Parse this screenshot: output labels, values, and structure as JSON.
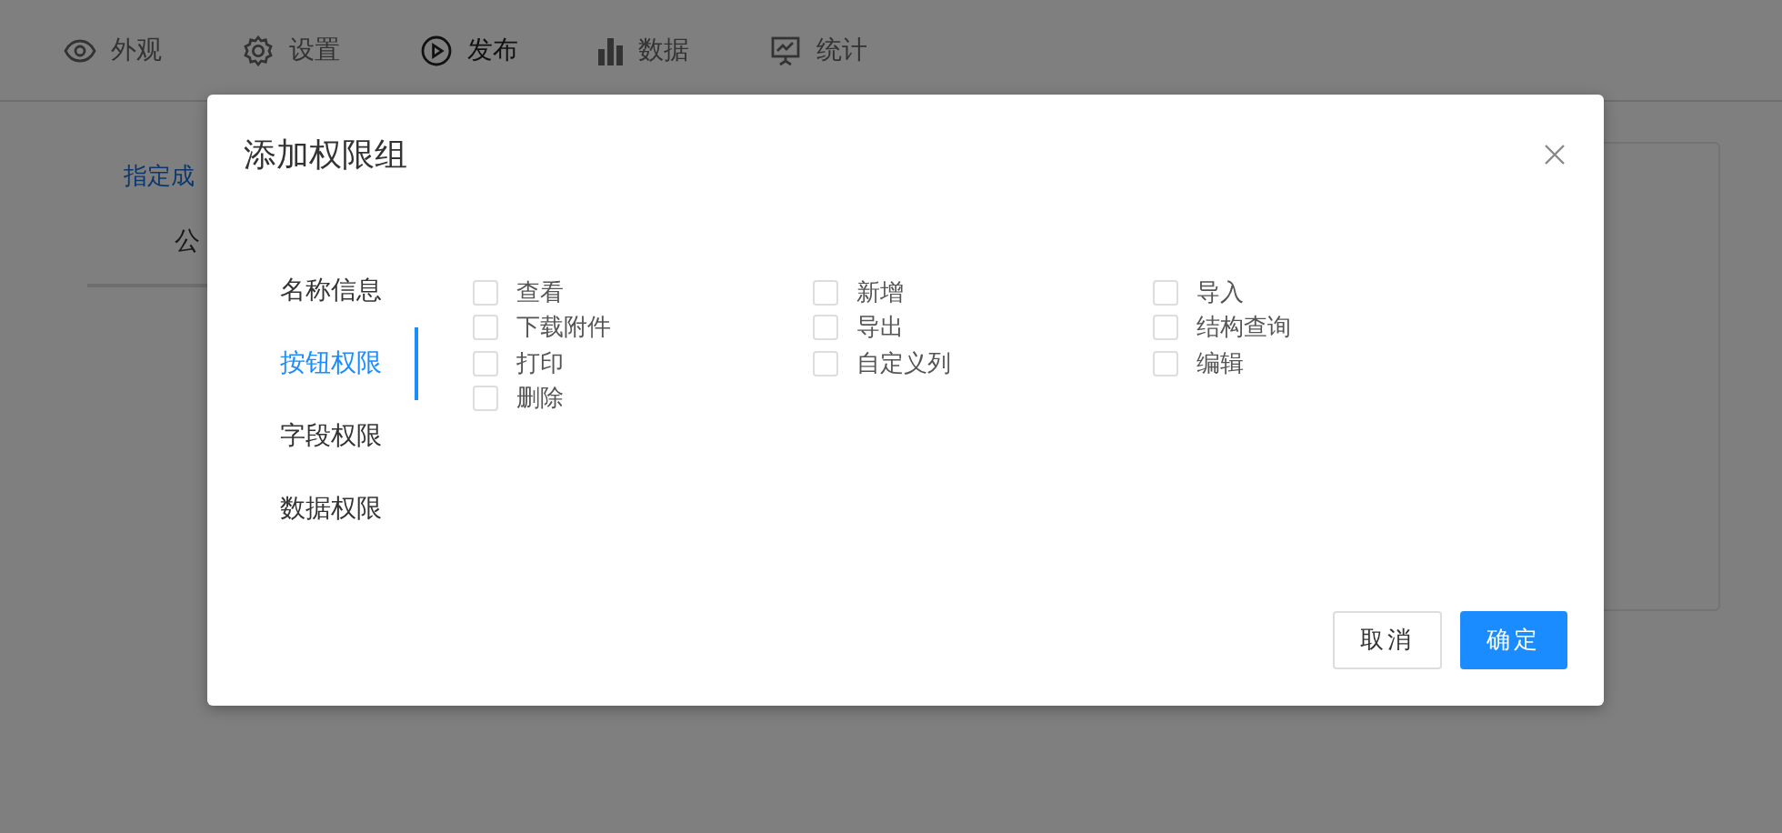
{
  "nav": [
    {
      "label": "外观",
      "kind": "eye",
      "selected": false
    },
    {
      "label": "设置",
      "kind": "gear",
      "selected": false
    },
    {
      "label": "发布",
      "kind": "play",
      "selected": true
    },
    {
      "label": "数据",
      "kind": "bars",
      "selected": false
    },
    {
      "label": "统计",
      "kind": "board",
      "selected": false
    }
  ],
  "background": {
    "link": "指定成",
    "tab": "公"
  },
  "dialog": {
    "title": "添加权限组",
    "menu": [
      {
        "label": "名称信息",
        "selected": false
      },
      {
        "label": "按钮权限",
        "selected": true
      },
      {
        "label": "字段权限",
        "selected": false
      },
      {
        "label": "数据权限",
        "selected": false
      }
    ],
    "permissions": [
      {
        "label": "查看",
        "checked": false
      },
      {
        "label": "新增",
        "checked": false
      },
      {
        "label": "导入",
        "checked": false
      },
      {
        "label": "下载附件",
        "checked": false
      },
      {
        "label": "导出",
        "checked": false
      },
      {
        "label": "结构查询",
        "checked": false
      },
      {
        "label": "打印",
        "checked": false
      },
      {
        "label": "自定义列",
        "checked": false
      },
      {
        "label": "编辑",
        "checked": false
      },
      {
        "label": "删除",
        "checked": false
      }
    ],
    "cancel": "取消",
    "confirm": "确定"
  }
}
